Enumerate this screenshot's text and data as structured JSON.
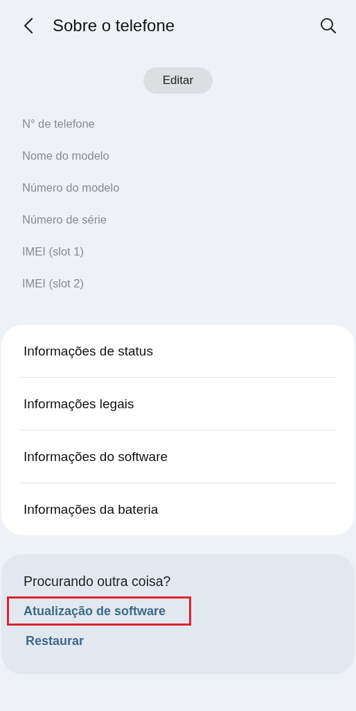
{
  "header": {
    "title": "Sobre o telefone"
  },
  "edit_button": "Editar",
  "info_labels": [
    "N° de telefone",
    "Nome do modelo",
    "Número do modelo",
    "Número de série",
    "IMEI (slot 1)",
    "IMEI (slot 2)"
  ],
  "menu_items": [
    "Informações de status",
    "Informações legais",
    "Informações do software",
    "Informações da bateria"
  ],
  "suggestions": {
    "title": "Procurando outra coisa?",
    "links": [
      {
        "label": "Atualização de software",
        "highlighted": true
      },
      {
        "label": "Restaurar",
        "highlighted": false
      }
    ]
  }
}
